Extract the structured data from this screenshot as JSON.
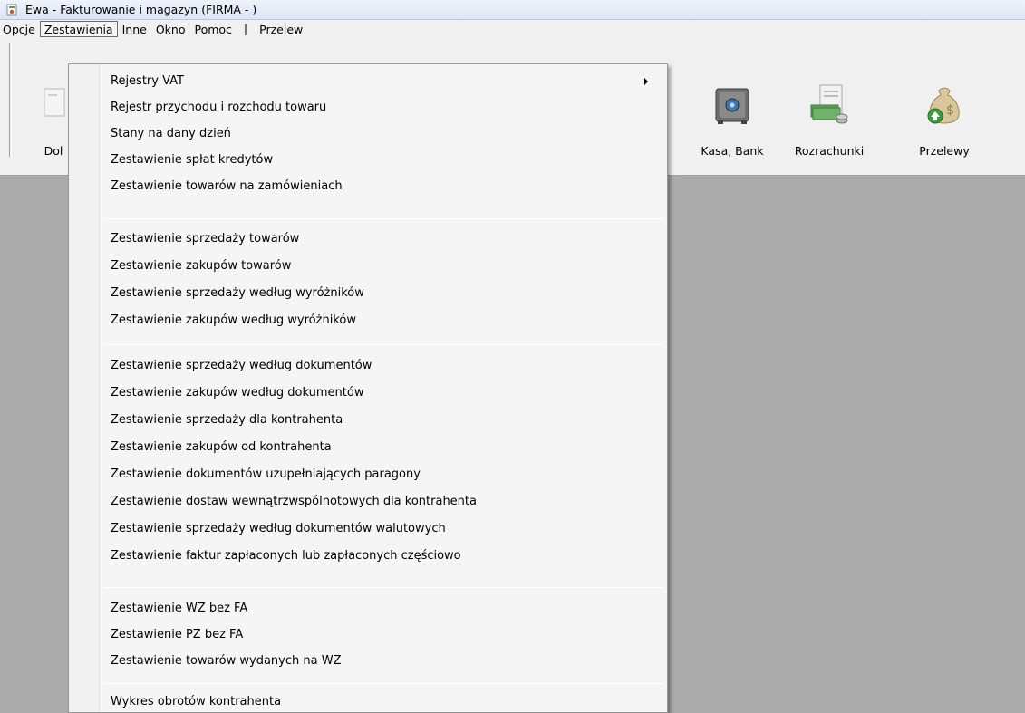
{
  "window": {
    "title": "Ewa - Fakturowanie i magazyn (FIRMA - )"
  },
  "menubar": {
    "items": [
      "Opcje",
      "Zestawienia",
      "Inne",
      "Okno",
      "Pomoc",
      "|",
      "Przelew"
    ]
  },
  "toolbar": {
    "buttons": [
      {
        "label": "Dol",
        "icon": "document-icon"
      },
      {
        "label": "Kasa, Bank",
        "icon": "safe-icon"
      },
      {
        "label": "Rozrachunki",
        "icon": "money-document-icon"
      },
      {
        "label": "Przelewy",
        "icon": "money-bag-icon"
      }
    ]
  },
  "dropdown": {
    "items": [
      "Rejestry VAT",
      "Rejestr przychodu i rozchodu towaru",
      "Stany na dany dzień",
      "Zestawienie spłat kredytów",
      "Zestawienie towarów na zamówieniach",
      "Zestawienie sprzedaży towarów",
      "Zestawienie zakupów towarów",
      "Zestawienie sprzedaży według wyróżników",
      "Zestawienie zakupów według wyróżników",
      "Zestawienie sprzedaży według dokumentów",
      "Zestawienie zakupów według dokumentów",
      "Zestawienie sprzedaży dla kontrahenta",
      "Zestawienie zakupów od kontrahenta",
      "Zestawienie dokumentów uzupełniających paragony",
      "Zestawienie dostaw wewnątrzwspólnotowych dla kontrahenta",
      "Zestawienie sprzedaży według dokumentów walutowych",
      "Zestawienie faktur zapłaconych lub zapłaconych częściowo",
      "Zestawienie WZ bez FA",
      "Zestawienie PZ bez FA",
      "Zestawienie towarów wydanych na WZ",
      "Wykres obrotów kontrahenta"
    ]
  }
}
